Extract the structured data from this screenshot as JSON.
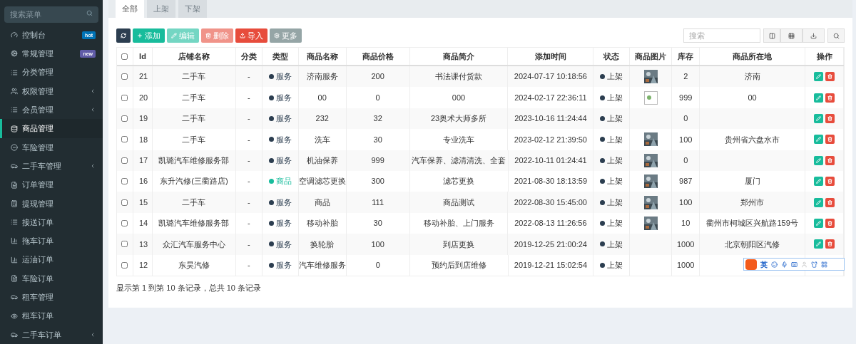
{
  "sidebar": {
    "search": {
      "placeholder": "搜索菜单"
    },
    "items": [
      {
        "label": "控制台",
        "kind": "gauge",
        "badge": {
          "text": "hot",
          "color": "#0073b7"
        },
        "selected": false,
        "expandable": false
      },
      {
        "label": "常规管理",
        "kind": "cogs",
        "badge": {
          "text": "new",
          "color": "#605ca8"
        },
        "selected": false,
        "expandable": false
      },
      {
        "label": "分类管理",
        "kind": "list",
        "selected": false,
        "expandable": false
      },
      {
        "label": "权限管理",
        "kind": "users",
        "selected": false,
        "expandable": true
      },
      {
        "label": "会员管理",
        "kind": "list",
        "selected": false,
        "expandable": true
      },
      {
        "label": "商品管理",
        "kind": "database",
        "selected": true,
        "expandable": false
      },
      {
        "label": "车险管理",
        "kind": "minus-circle",
        "selected": false,
        "expandable": false
      },
      {
        "label": "二手车管理",
        "kind": "car",
        "selected": false,
        "expandable": true
      },
      {
        "label": "订单管理",
        "kind": "file",
        "selected": false,
        "expandable": false
      },
      {
        "label": "提现管理",
        "kind": "calculator",
        "selected": false,
        "expandable": false
      },
      {
        "label": "接送订单",
        "kind": "list",
        "selected": false,
        "expandable": false
      },
      {
        "label": "拖车订单",
        "kind": "chart",
        "selected": false,
        "expandable": false
      },
      {
        "label": "运油订单",
        "kind": "chart",
        "selected": false,
        "expandable": false
      },
      {
        "label": "车险订单",
        "kind": "file",
        "selected": false,
        "expandable": false
      },
      {
        "label": "租车管理",
        "kind": "car",
        "selected": false,
        "expandable": false
      },
      {
        "label": "租车订单",
        "kind": "eye",
        "selected": false,
        "expandable": false
      },
      {
        "label": "二手车订单",
        "kind": "car",
        "selected": false,
        "expandable": true
      }
    ]
  },
  "tabs": [
    {
      "label": "全部",
      "selected": true
    },
    {
      "label": "上架",
      "selected": false
    },
    {
      "label": "下架",
      "selected": false
    }
  ],
  "toolbar": {
    "buttons": [
      {
        "kind": "refresh",
        "disabled": false
      },
      {
        "kind": "add",
        "label": "添加",
        "disabled": false
      },
      {
        "kind": "edit",
        "label": "编辑",
        "disabled": true
      },
      {
        "kind": "delete",
        "label": "删除",
        "disabled": true
      },
      {
        "kind": "import",
        "label": "导入",
        "disabled": false
      },
      {
        "kind": "more",
        "label": "更多",
        "disabled": false
      }
    ],
    "search": {
      "placeholder": "搜索"
    }
  },
  "table": {
    "all_checked": false,
    "columns": [
      "Id",
      "店铺名称",
      "分类",
      "类型",
      "商品名称",
      "商品价格",
      "商品简介",
      "添加时间",
      "状态",
      "商品图片",
      "库存",
      "商品所在地",
      "操作"
    ],
    "rows": [
      {
        "checked": false,
        "id": "21",
        "shop": "二手车",
        "category": "-",
        "type": {
          "label": "服务",
          "color": "#2c3e50"
        },
        "name": "济南服务",
        "price": "200",
        "intro": "书法课付货款",
        "added": "2024-07-17 10:18:56",
        "status": "上架",
        "stock": "2",
        "location": "济南"
      },
      {
        "checked": false,
        "id": "20",
        "shop": "二手车",
        "category": "-",
        "type": {
          "label": "服务",
          "color": "#2c3e50"
        },
        "name": "00",
        "price": "0",
        "intro": "000",
        "added": "2024-02-17 22:36:11",
        "status": "上架",
        "image": {
          "kind": "broken"
        },
        "stock": "999",
        "location": "00"
      },
      {
        "checked": false,
        "id": "19",
        "shop": "二手车",
        "category": "-",
        "type": {
          "label": "服务",
          "color": "#2c3e50"
        },
        "name": "232",
        "price": "32",
        "intro": "23奥术大师多所",
        "added": "2023-10-16 11:24:44",
        "status": "上架",
        "stock": "0"
      },
      {
        "checked": false,
        "id": "18",
        "shop": "二手车",
        "category": "-",
        "type": {
          "label": "服务",
          "color": "#2c3e50"
        },
        "name": "洗车",
        "price": "30",
        "intro": "专业洗车",
        "added": "2023-02-12 21:39:50",
        "status": "上架",
        "stock": "100",
        "location": "贵州省六盘水市"
      },
      {
        "checked": false,
        "id": "17",
        "shop": "凯璐汽车维修服务部",
        "category": "-",
        "type": {
          "label": "服务",
          "color": "#2c3e50"
        },
        "name": "机油保养",
        "price": "999",
        "intro": "汽车保养、滤清清洗、全套",
        "added": "2022-10-11 01:24:41",
        "status": "上架",
        "stock": "0"
      },
      {
        "checked": false,
        "id": "16",
        "shop": "东升汽修(三衢路店)",
        "category": "-",
        "type": {
          "label": "商品",
          "color": "#18bc9c"
        },
        "name": "空调滤芯更换",
        "price": "300",
        "intro": "滤芯更换",
        "added": "2021-08-30 18:13:59",
        "status": "上架",
        "stock": "987",
        "location": "厦门"
      },
      {
        "checked": false,
        "id": "15",
        "shop": "二手车",
        "category": "-",
        "type": {
          "label": "服务",
          "color": "#2c3e50"
        },
        "name": "商品",
        "price": "111",
        "intro": "商品测试",
        "added": "2022-08-30 15:45:00",
        "status": "上架",
        "stock": "100",
        "location": "郑州市"
      },
      {
        "checked": false,
        "id": "14",
        "shop": "凯璐汽车维修服务部",
        "category": "-",
        "type": {
          "label": "服务",
          "color": "#2c3e50"
        },
        "name": "移动补胎",
        "price": "30",
        "intro": "移动补胎、上门服务",
        "added": "2022-08-13 11:26:56",
        "status": "上架",
        "stock": "10",
        "location": "衢州市柯城区兴航路159号"
      },
      {
        "checked": false,
        "id": "13",
        "shop": "众汇汽车服务中心",
        "category": "-",
        "type": {
          "label": "服务",
          "color": "#2c3e50"
        },
        "name": "换轮胎",
        "price": "100",
        "intro": "到店更换",
        "added": "2019-12-25 21:00:24",
        "status": "上架",
        "stock": "1000",
        "location": "北京朝阳区汽修"
      },
      {
        "checked": false,
        "id": "12",
        "shop": "东昊汽修",
        "category": "-",
        "type": {
          "label": "服务",
          "color": "#2c3e50"
        },
        "name": "汽车维修服务",
        "price": "0",
        "intro": "预约后到店维修",
        "added": "2019-12-21 15:02:54",
        "status": "上架",
        "stock": "1000"
      }
    ]
  },
  "pagination": {
    "summary": "显示第 1 到第 10 条记录，总共 10 条记录"
  },
  "ime_bar": {
    "mode": "英"
  }
}
